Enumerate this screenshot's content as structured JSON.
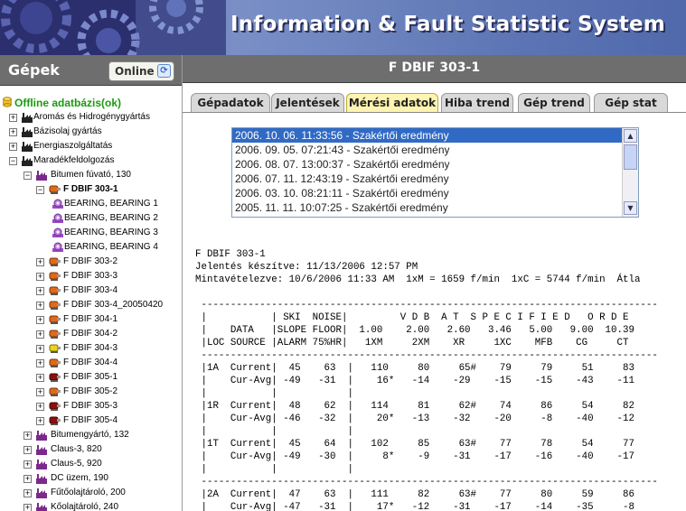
{
  "banner": {
    "title": "Information & Fault Statistic System"
  },
  "sidebar": {
    "title": "Gépek",
    "online_label": "Online",
    "root": "Offline adatbázis(ok)",
    "tree": [
      {
        "label": "Aromás és Hidrogénygyártás",
        "lvl": 1,
        "exp": "+",
        "icon": "plant-icon"
      },
      {
        "label": "Bázisolaj gyártás",
        "lvl": 1,
        "exp": "+",
        "icon": "plant-icon"
      },
      {
        "label": "Energiaszolgáltatás",
        "lvl": 1,
        "exp": "+",
        "icon": "plant-icon"
      },
      {
        "label": "Maradékfeldolgozás",
        "lvl": 1,
        "exp": "-",
        "icon": "plant-icon"
      },
      {
        "label": "Bitumen fúvató, 130",
        "lvl": 2,
        "exp": "-",
        "icon": "unit-icon"
      },
      {
        "label": "F DBIF 303-1",
        "lvl": 3,
        "exp": "-",
        "icon": "machine-icon",
        "bold": true
      },
      {
        "label": "BEARING, BEARING 1",
        "lvl": 4,
        "exp": "",
        "icon": "bearing-icon"
      },
      {
        "label": "BEARING, BEARING 2",
        "lvl": 4,
        "exp": "",
        "icon": "bearing-icon"
      },
      {
        "label": "BEARING, BEARING 3",
        "lvl": 4,
        "exp": "",
        "icon": "bearing-icon"
      },
      {
        "label": "BEARING, BEARING 4",
        "lvl": 4,
        "exp": "",
        "icon": "bearing-icon"
      },
      {
        "label": "F DBIF 303-2",
        "lvl": 3,
        "exp": "+",
        "icon": "machine-icon"
      },
      {
        "label": "F DBIF 303-3",
        "lvl": 3,
        "exp": "+",
        "icon": "machine-icon"
      },
      {
        "label": "F DBIF 303-4",
        "lvl": 3,
        "exp": "+",
        "icon": "machine-icon"
      },
      {
        "label": "F DBIF 303-4_20050420",
        "lvl": 3,
        "exp": "+",
        "icon": "machine-icon"
      },
      {
        "label": "F DBIF 304-1",
        "lvl": 3,
        "exp": "+",
        "icon": "machine-icon"
      },
      {
        "label": "F DBIF 304-2",
        "lvl": 3,
        "exp": "+",
        "icon": "machine-icon"
      },
      {
        "label": "F DBIF 304-3",
        "lvl": 3,
        "exp": "+",
        "icon": "machine-yellow-icon"
      },
      {
        "label": "F DBIF 304-4",
        "lvl": 3,
        "exp": "+",
        "icon": "machine-icon"
      },
      {
        "label": "F DBIF 305-1",
        "lvl": 3,
        "exp": "+",
        "icon": "machine-red-icon"
      },
      {
        "label": "F DBIF 305-2",
        "lvl": 3,
        "exp": "+",
        "icon": "machine-icon"
      },
      {
        "label": "F DBIF 305-3",
        "lvl": 3,
        "exp": "+",
        "icon": "machine-red-icon"
      },
      {
        "label": "F DBIF 305-4",
        "lvl": 3,
        "exp": "+",
        "icon": "machine-red-icon"
      },
      {
        "label": "Bitumengyártó, 132",
        "lvl": 2,
        "exp": "+",
        "icon": "unit-icon"
      },
      {
        "label": "Claus-3, 820",
        "lvl": 2,
        "exp": "+",
        "icon": "unit-icon"
      },
      {
        "label": "Claus-5, 920",
        "lvl": 2,
        "exp": "+",
        "icon": "unit-icon"
      },
      {
        "label": "DC üzem, 190",
        "lvl": 2,
        "exp": "+",
        "icon": "unit-icon"
      },
      {
        "label": "Fűtőolajtároló, 200",
        "lvl": 2,
        "exp": "+",
        "icon": "unit-icon"
      },
      {
        "label": "Kőolajtároló, 240",
        "lvl": 2,
        "exp": "+",
        "icon": "unit-icon"
      }
    ]
  },
  "main": {
    "title": "F DBIF 303-1",
    "tabs": [
      "Gépadatok",
      "Jelentések",
      "Mérési adatok",
      "Hiba trend",
      "Gép trend",
      "Gép stat"
    ],
    "active_tab": 2,
    "measurements": [
      "2006. 10. 06. 11:33:56 - Szakértői eredmény",
      "2006. 09. 05. 07:21:43 - Szakértői eredmény",
      "2006. 08. 07. 13:00:37 - Szakértői eredmény",
      "2006. 07. 11. 12:43:19 - Szakértői eredmény",
      "2006. 03. 10. 08:21:11 - Szakértői eredmény",
      "2005. 11. 11. 10:07:25 - Szakértői eredmény"
    ],
    "report_lines": [
      "F DBIF 303-1",
      "Jelentés készítve: 11/13/2006 12:57 PM",
      "Mintavételezve: 10/6/2006 11:33 AM  1xM = 1659 f/min  1xC = 5744 f/min  Átla",
      "",
      " ------------------------------------------------------------------------------",
      " |           | SKI  NOISE|         V D B  A T  S P E C I F I E D   O R D E",
      " |    DATA   |SLOPE FLOOR|  1.00    2.00   2.60   3.46   5.00   9.00  10.39",
      " |LOC SOURCE |ALARM 75%HR|   1XM     2XM    XR     1XC    MFB    CG     CT",
      " ------------------------------------------------------------------------------",
      " |1A  Current|  45    63  |   110     80     65#    79     79     51     83",
      " |    Cur-Avg| -49   -31  |    16*   -14    -29    -15    -15    -43    -11",
      " |           |            |",
      " |1R  Current|  48    62  |   114     81     62#    74     86     54     82",
      " |    Cur-Avg| -46   -32  |    20*   -13    -32    -20     -8    -40    -12",
      " |           |            |",
      " |1T  Current|  45    64  |   102     85     63#    77     78     54     77",
      " |    Cur-Avg| -49   -30  |     8*    -9    -31    -17    -16    -40    -17",
      " |           |            |",
      " ------------------------------------------------------------------------------",
      " |2A  Current|  47    63  |   111     82     63#    77     80     59     86",
      " |    Cur-Avg| -47   -31  |    17*   -12    -31    -17    -14    -35     -8"
    ]
  },
  "colors": {
    "header_bg": "#6e6e6e",
    "tree_root": "#1a9a0e",
    "tab_active": "#fcf4b0",
    "list_selected": "#316ac5"
  }
}
